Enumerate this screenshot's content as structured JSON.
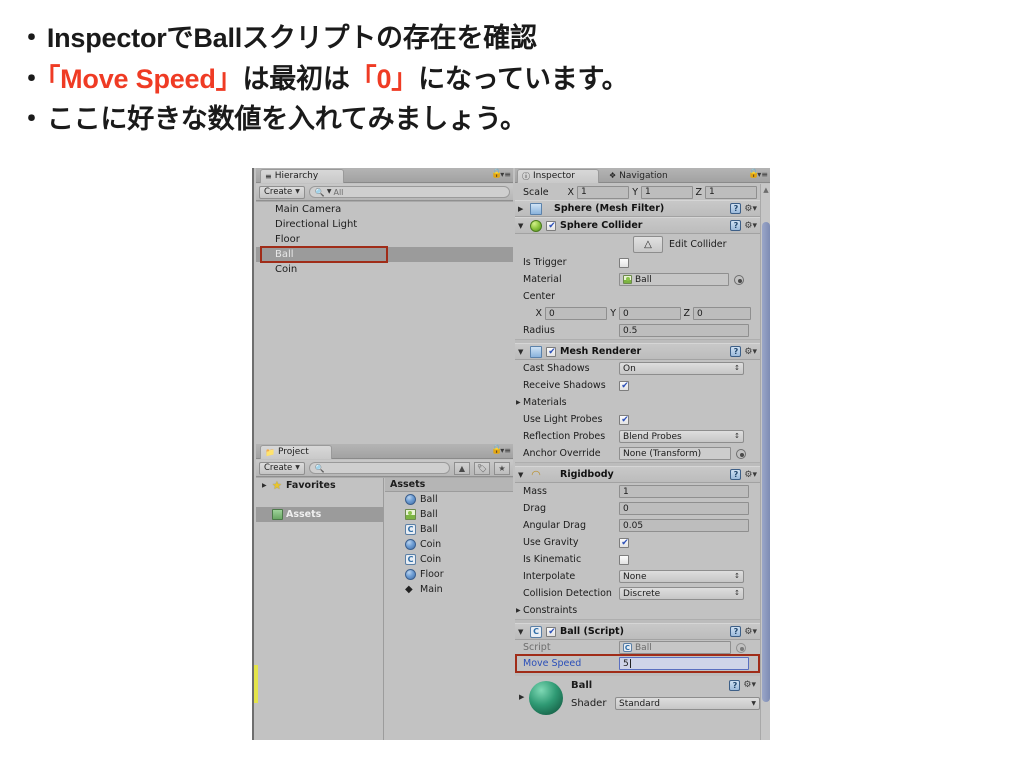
{
  "slide": {
    "bullets": [
      {
        "mark": "・",
        "segments": [
          {
            "text": "InspectorでBallスクリプトの存在を確認",
            "color": "black"
          }
        ]
      },
      {
        "mark": "・",
        "segments": [
          {
            "text": "「Move Speed」",
            "color": "red"
          },
          {
            "text": "は最初は",
            "color": "black"
          },
          {
            "text": "「0」",
            "color": "red"
          },
          {
            "text": "になっています。",
            "color": "black"
          }
        ]
      },
      {
        "mark": "・",
        "segments": [
          {
            "text": "ここに好きな数値を入れてみましょう。",
            "color": "black"
          }
        ]
      }
    ]
  },
  "colors": {
    "highlight_red": "#a02c18",
    "accent_red": "#ef3b24",
    "label_blue": "#2b4fb8",
    "panel_bg": "#c2c2c2"
  },
  "hierarchy": {
    "tab_label": "Hierarchy",
    "tab_icon": "hierarchy-icon",
    "create_label": "Create",
    "search_placeholder": "All",
    "items": [
      {
        "label": "Main Camera",
        "selected": false
      },
      {
        "label": "Directional Light",
        "selected": false
      },
      {
        "label": "Floor",
        "selected": false
      },
      {
        "label": "Ball",
        "selected": true
      },
      {
        "label": "Coin",
        "selected": false
      }
    ]
  },
  "project": {
    "tab_label": "Project",
    "tab_icon": "folder-icon",
    "create_label": "Create",
    "search_placeholder": "",
    "tree": [
      {
        "label": "Favorites",
        "icon": "star-icon",
        "expandable": true,
        "selected": false
      },
      {
        "label": "Assets",
        "icon": "folder-icon",
        "expandable": false,
        "selected": true
      }
    ],
    "assets_header": "Assets",
    "assets": [
      {
        "label": "Ball",
        "icon": "sphere-icon"
      },
      {
        "label": "Ball",
        "icon": "material-icon"
      },
      {
        "label": "Ball",
        "icon": "csharp-script-icon"
      },
      {
        "label": "Coin",
        "icon": "sphere-icon"
      },
      {
        "label": "Coin",
        "icon": "csharp-script-icon"
      },
      {
        "label": "Floor",
        "icon": "sphere-icon"
      },
      {
        "label": "Main",
        "icon": "unity-scene-icon"
      }
    ]
  },
  "inspector": {
    "tabs": [
      {
        "label": "Inspector",
        "icon": "info-icon",
        "active": true
      },
      {
        "label": "Navigation",
        "icon": "navigation-icon",
        "active": false
      }
    ],
    "transform_scale": {
      "label": "Scale",
      "x_label": "X",
      "x_value": "1",
      "y_label": "Y",
      "y_value": "1",
      "z_label": "Z",
      "z_value": "1"
    },
    "mesh_filter": {
      "title": "Sphere (Mesh Filter)"
    },
    "sphere_collider": {
      "title": "Sphere Collider",
      "enabled": true,
      "edit_collider_label": "Edit Collider",
      "is_trigger_label": "Is Trigger",
      "is_trigger_value": false,
      "material_label": "Material",
      "material_value": "Ball",
      "center_label": "Center",
      "center_x_label": "X",
      "center_x": "0",
      "center_y_label": "Y",
      "center_y": "0",
      "center_z_label": "Z",
      "center_z": "0",
      "radius_label": "Radius",
      "radius_value": "0.5"
    },
    "mesh_renderer": {
      "title": "Mesh Renderer",
      "enabled": true,
      "cast_shadows_label": "Cast Shadows",
      "cast_shadows_value": "On",
      "receive_shadows_label": "Receive Shadows",
      "receive_shadows_value": true,
      "materials_label": "Materials",
      "use_light_probes_label": "Use Light Probes",
      "use_light_probes_value": true,
      "reflection_probes_label": "Reflection Probes",
      "reflection_probes_value": "Blend Probes",
      "anchor_override_label": "Anchor Override",
      "anchor_override_value": "None (Transform)"
    },
    "rigidbody": {
      "title": "Rigidbody",
      "mass_label": "Mass",
      "mass_value": "1",
      "drag_label": "Drag",
      "drag_value": "0",
      "angular_drag_label": "Angular Drag",
      "angular_drag_value": "0.05",
      "use_gravity_label": "Use Gravity",
      "use_gravity_value": true,
      "is_kinematic_label": "Is Kinematic",
      "is_kinematic_value": false,
      "interpolate_label": "Interpolate",
      "interpolate_value": "None",
      "collision_detection_label": "Collision Detection",
      "collision_detection_value": "Discrete",
      "constraints_label": "Constraints"
    },
    "ball_script": {
      "title": "Ball (Script)",
      "enabled": true,
      "script_label": "Script",
      "script_value": "Ball",
      "move_speed_label": "Move Speed",
      "move_speed_value": "5"
    },
    "material": {
      "name": "Ball",
      "shader_label": "Shader",
      "shader_value": "Standard"
    }
  }
}
